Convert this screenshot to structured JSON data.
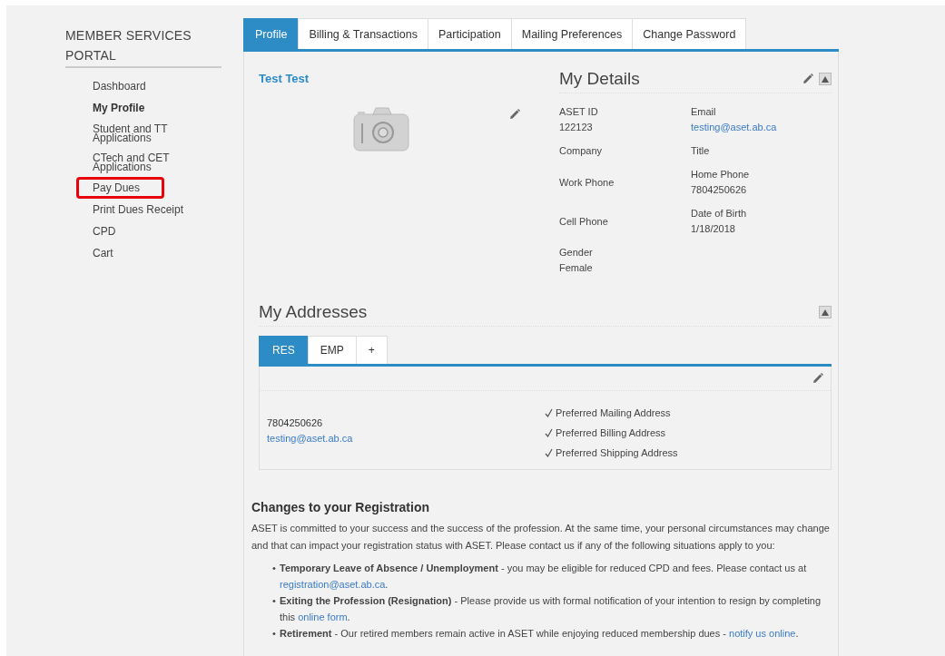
{
  "sidebar": {
    "title": "MEMBER SERVICES PORTAL",
    "items": [
      {
        "label": "Dashboard",
        "selected": false,
        "highlighted": false
      },
      {
        "label": "My Profile",
        "selected": true,
        "highlighted": false
      },
      {
        "label": "Student and TT Applications",
        "selected": false,
        "highlighted": false
      },
      {
        "label": "CTech and CET Applications",
        "selected": false,
        "highlighted": false
      },
      {
        "label": "Pay Dues",
        "selected": false,
        "highlighted": true
      },
      {
        "label": "Print Dues Receipt",
        "selected": false,
        "highlighted": false
      },
      {
        "label": "CPD",
        "selected": false,
        "highlighted": false
      },
      {
        "label": "Cart",
        "selected": false,
        "highlighted": false
      }
    ]
  },
  "tabs": [
    {
      "label": "Profile",
      "selected": true
    },
    {
      "label": "Billing & Transactions",
      "selected": false
    },
    {
      "label": "Participation",
      "selected": false
    },
    {
      "label": "Mailing Preferences",
      "selected": false
    },
    {
      "label": "Change Password",
      "selected": false
    }
  ],
  "profile": {
    "name": "Test Test"
  },
  "details": {
    "title": "My Details",
    "rows": [
      [
        {
          "label": "ASET ID",
          "value": "122123",
          "kind": "text"
        },
        {
          "label": "Email",
          "value": "testing@aset.ab.ca",
          "kind": "link"
        }
      ],
      [
        {
          "label": "Company"
        },
        {
          "label": "Title"
        }
      ],
      [
        {
          "label": "Work Phone"
        },
        {
          "label": "Home Phone",
          "value": "7804250626",
          "kind": "text"
        }
      ],
      [
        {
          "label": "Cell Phone"
        },
        {
          "label": "Date of Birth",
          "value": "1/18/2018",
          "kind": "text"
        }
      ],
      [
        {
          "label": "Gender",
          "value": "Female",
          "kind": "text"
        }
      ]
    ]
  },
  "addresses": {
    "title": "My Addresses",
    "tabs": [
      {
        "label": "RES",
        "selected": true
      },
      {
        "label": "EMP",
        "selected": false
      },
      {
        "label": "+",
        "selected": false
      }
    ],
    "phone": "7804250626",
    "email": "testing@aset.ab.ca",
    "preferences": [
      {
        "label": "Preferred Mailing Address",
        "checked": true
      },
      {
        "label": "Preferred Billing Address",
        "checked": true
      },
      {
        "label": "Preferred Shipping Address",
        "checked": true
      }
    ]
  },
  "registration": {
    "title": "Changes to your Registration",
    "intro": "ASET is committed to your success and the success of the profession. At the same time, your personal circumstances may change and that can impact your registration status with ASET. Please contact us if any of the following situations apply to you:",
    "items": [
      {
        "bullet": "•",
        "text": "**Temporary Leave of Absence / Unemployment** - you may be eligible for reduced CPD and fees. Please contact us at ",
        "link": "registration@aset.ab.ca",
        "after": "."
      },
      {
        "bullet": "•",
        "text": "**Exiting the Profession (Resignation)** - Please provide us with formal notification of your intention to resign by completing this ",
        "link": "online form",
        "after": "."
      },
      {
        "bullet": "•",
        "text": "**Retirement** - Our retired members remain active in ASET while enjoying reduced membership dues - ",
        "link": "notify us online",
        "after": "."
      }
    ]
  }
}
